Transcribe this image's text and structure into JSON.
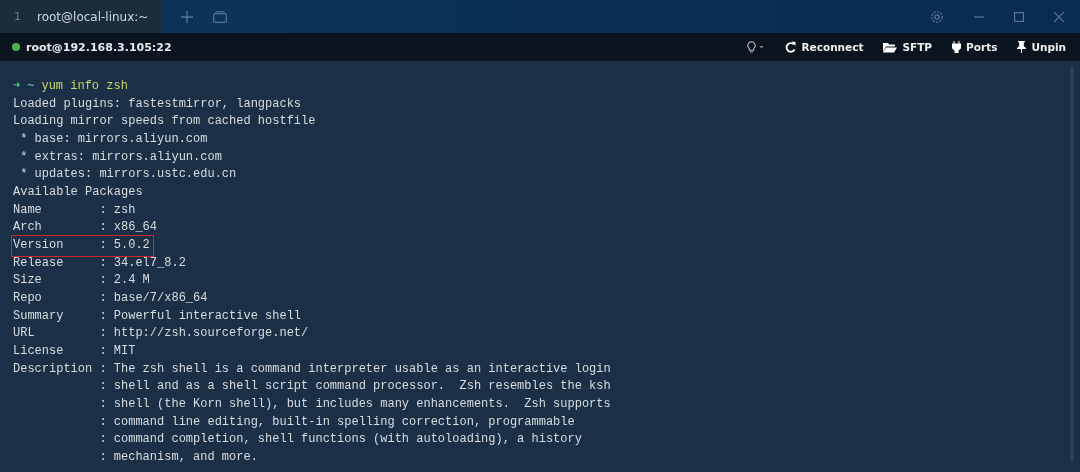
{
  "tabs": [
    {
      "number": "1",
      "title": "root@local-linux:~",
      "selected": true
    }
  ],
  "session": {
    "host": "root@192.168.3.105:22",
    "connected": true
  },
  "toolbar": [
    {
      "kind": "bulb"
    },
    {
      "kind": "reconnect",
      "label": "Reconnect"
    },
    {
      "kind": "sftp",
      "label": "SFTP"
    },
    {
      "kind": "ports",
      "label": "Ports"
    },
    {
      "kind": "pin",
      "label": "Unpin"
    }
  ],
  "prompt": {
    "arrow": "➜",
    "dir": "~",
    "command": "yum info zsh"
  },
  "lines": [
    {
      "text": "Loaded plugins: fastestmirror, langpacks",
      "boxed": false
    },
    {
      "text": "Loading mirror speeds from cached hostfile",
      "boxed": false
    },
    {
      "text": " * base: mirrors.aliyun.com",
      "boxed": false
    },
    {
      "text": " * extras: mirrors.aliyun.com",
      "boxed": false
    },
    {
      "text": " * updates: mirrors.ustc.edu.cn",
      "boxed": false
    },
    {
      "text": "Available Packages",
      "boxed": false
    },
    {
      "text": "Name        : zsh",
      "boxed": false
    },
    {
      "text": "Arch        : x86_64",
      "boxed": false
    },
    {
      "text": "Version     : 5.0.2",
      "boxed": true
    },
    {
      "text": "Release     : 34.el7_8.2",
      "boxed": false
    },
    {
      "text": "Size        : 2.4 M",
      "boxed": false
    },
    {
      "text": "Repo        : base/7/x86_64",
      "boxed": false
    },
    {
      "text": "Summary     : Powerful interactive shell",
      "boxed": false
    },
    {
      "text": "URL         : http://zsh.sourceforge.net/",
      "boxed": false
    },
    {
      "text": "License     : MIT",
      "boxed": false
    },
    {
      "text": "Description : The zsh shell is a command interpreter usable as an interactive login",
      "boxed": false
    },
    {
      "text": "            : shell and as a shell script command processor.  Zsh resembles the ksh",
      "boxed": false
    },
    {
      "text": "            : shell (the Korn shell), but includes many enhancements.  Zsh supports",
      "boxed": false
    },
    {
      "text": "            : command line editing, built-in spelling correction, programmable",
      "boxed": false
    },
    {
      "text": "            : command completion, shell functions (with autoloading), a history",
      "boxed": false
    },
    {
      "text": "            : mechanism, and more.",
      "boxed": false
    }
  ]
}
